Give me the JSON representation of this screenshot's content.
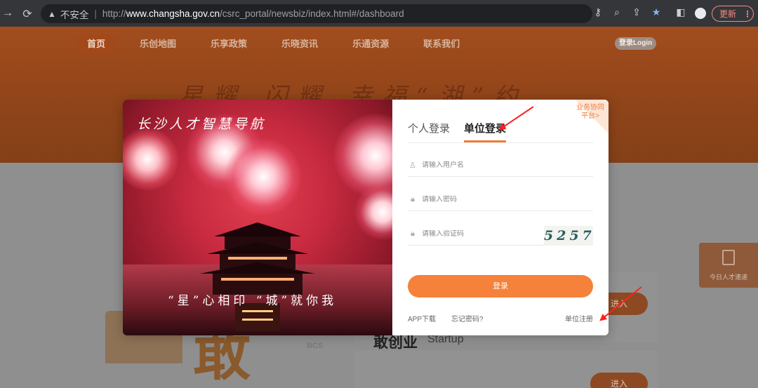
{
  "browser": {
    "insecure_label": "不安全",
    "url_protocol": "http://",
    "url_host": "www.changsha.gov.cn",
    "url_path": "/csrc_portal/newsbiz/index.html#/dashboard",
    "update_label": "更新"
  },
  "site": {
    "nav": [
      "首页",
      "乐创地图",
      "乐享政策",
      "乐晓资讯",
      "乐通资源",
      "联系我们"
    ],
    "login_chip": "登录Login",
    "banner_text": "星耀 闪耀 幸福“湖”约",
    "side_widget_label": "今日人才速递",
    "enter_label": "进入",
    "startup_title": "敢创业",
    "startup_subtitle": "Startup",
    "bcs_label": "BCS",
    "big_glyph": "敢"
  },
  "modal": {
    "image_title": "长沙人才智慧导航",
    "image_slogan": "“星”心相印 “城”就你我",
    "corner_label": "业务协同平台>",
    "tabs": [
      "个人登录",
      "单位登录"
    ],
    "active_tab": "单位登录",
    "username_placeholder": "请输入用户名",
    "password_placeholder": "请输入密码",
    "captcha_placeholder": "请输入验证码",
    "captcha_code": "5257",
    "submit_label": "登录",
    "app_download": "APP下载",
    "forgot_password": "忘记密码?",
    "unit_register": "单位注册"
  }
}
